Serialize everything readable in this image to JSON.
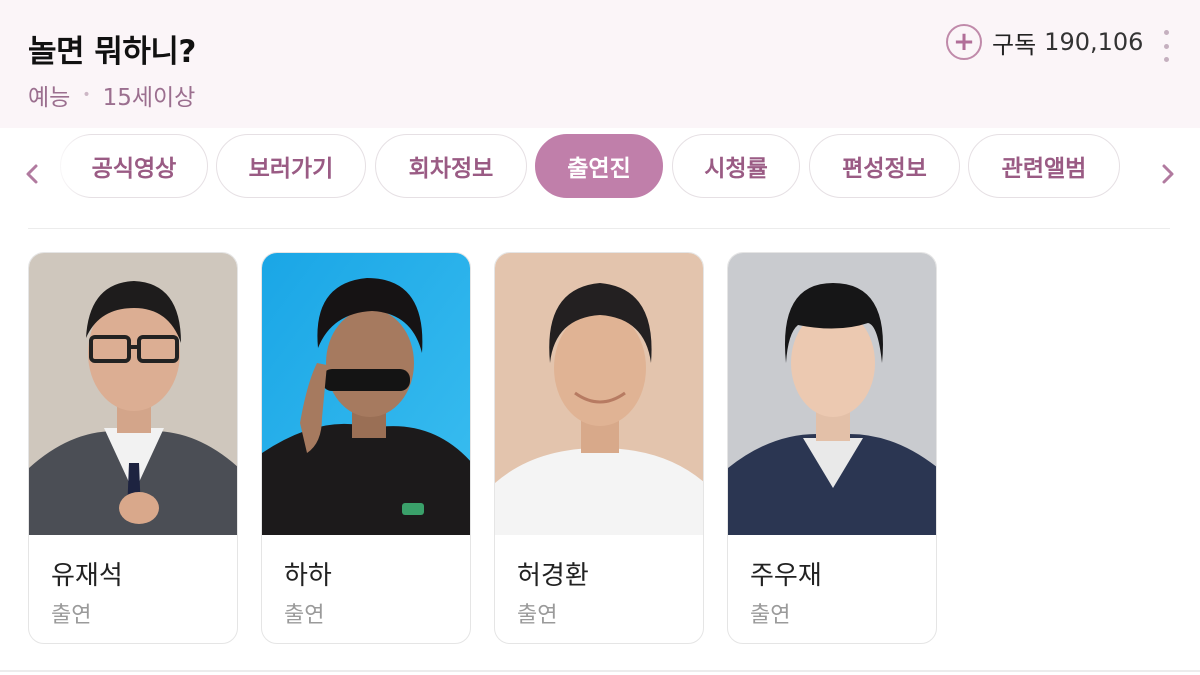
{
  "header": {
    "title": "놀면 뭐하니?",
    "genre": "예능",
    "rating": "15세이상",
    "subscribe_label": "구독",
    "subscribe_count": "190,106",
    "plus_icon": "plus-icon",
    "more_icon": "more-vertical-icon"
  },
  "tabs": [
    {
      "label": "공식영상",
      "active": false
    },
    {
      "label": "보러가기",
      "active": false
    },
    {
      "label": "회차정보",
      "active": false
    },
    {
      "label": "출연진",
      "active": true
    },
    {
      "label": "시청률",
      "active": false
    },
    {
      "label": "편성정보",
      "active": false
    },
    {
      "label": "관련앨범",
      "active": false
    }
  ],
  "nav": {
    "prev_icon": "chevron-left-icon",
    "next_icon": "chevron-right-icon"
  },
  "cast": [
    {
      "name": "유재석",
      "role": "출연"
    },
    {
      "name": "하하",
      "role": "출연"
    },
    {
      "name": "허경환",
      "role": "출연"
    },
    {
      "name": "주우재",
      "role": "출연"
    }
  ],
  "colors": {
    "accent": "#c07faa",
    "header_bg": "#fbf5f8",
    "tab_text": "#9a5b84"
  }
}
